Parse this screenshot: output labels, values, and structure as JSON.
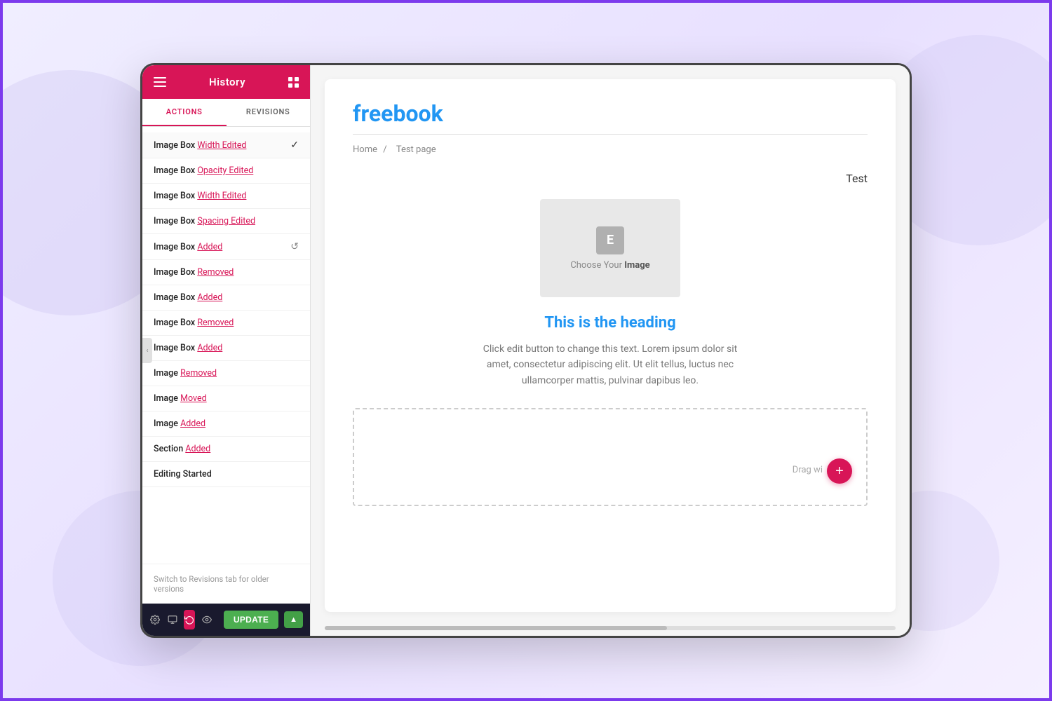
{
  "sidebar": {
    "header": {
      "title": "History",
      "hamburger_label": "menu",
      "grid_label": "grid"
    },
    "tabs": [
      {
        "id": "actions",
        "label": "ACTIONS",
        "active": true
      },
      {
        "id": "revisions",
        "label": "REVISIONS",
        "active": false
      }
    ],
    "history_items": [
      {
        "component": "Image Box",
        "action": "Width",
        "action_type": "Edited",
        "has_check": true,
        "has_undo": false
      },
      {
        "component": "Image Box",
        "action": "Opacity",
        "action_type": "Edited",
        "has_check": false,
        "has_undo": false
      },
      {
        "component": "Image Box",
        "action": "Width",
        "action_type": "Edited",
        "has_check": false,
        "has_undo": false
      },
      {
        "component": "Image Box",
        "action": "Spacing",
        "action_type": "Edited",
        "has_check": false,
        "has_undo": false
      },
      {
        "component": "Image Box",
        "action": "",
        "action_type": "Added",
        "has_check": false,
        "has_undo": true
      },
      {
        "component": "Image Box",
        "action": "",
        "action_type": "Removed",
        "has_check": false,
        "has_undo": false
      },
      {
        "component": "Image Box",
        "action": "",
        "action_type": "Added",
        "has_check": false,
        "has_undo": false
      },
      {
        "component": "Image Box",
        "action": "",
        "action_type": "Removed",
        "has_check": false,
        "has_undo": false
      },
      {
        "component": "Image Box",
        "action": "",
        "action_type": "Added",
        "has_check": false,
        "has_undo": false
      },
      {
        "component": "Image",
        "action": "",
        "action_type": "Removed",
        "has_check": false,
        "has_undo": false
      },
      {
        "component": "Image",
        "action": "",
        "action_type": "Moved",
        "has_check": false,
        "has_undo": false
      },
      {
        "component": "Image",
        "action": "",
        "action_type": "Added",
        "has_check": false,
        "has_undo": false
      },
      {
        "component": "Section",
        "action": "",
        "action_type": "Added",
        "has_check": false,
        "has_undo": false
      },
      {
        "component": "Editing Started",
        "action": "",
        "action_type": "",
        "has_check": false,
        "has_undo": false
      }
    ],
    "footer_note": "Switch to Revisions tab for older versions",
    "toolbar": {
      "update_label": "UPDATE",
      "update_arrow": "▲"
    }
  },
  "main": {
    "site_title": "freebook",
    "breadcrumb": {
      "home": "Home",
      "separator": "/",
      "current": "Test page"
    },
    "section_label": "Test",
    "image_placeholder": {
      "icon": "E",
      "text_prefix": "Choose Your ",
      "text_bold": "Image"
    },
    "widget_heading": "This is the heading",
    "widget_description": "Click edit button to change this text. Lorem ipsum dolor sit amet, consectetur adipiscing elit. Ut elit tellus, luctus nec ullamcorper mattis, pulvinar dapibus leo.",
    "empty_section": {
      "drag_text": "Drag wi"
    }
  }
}
